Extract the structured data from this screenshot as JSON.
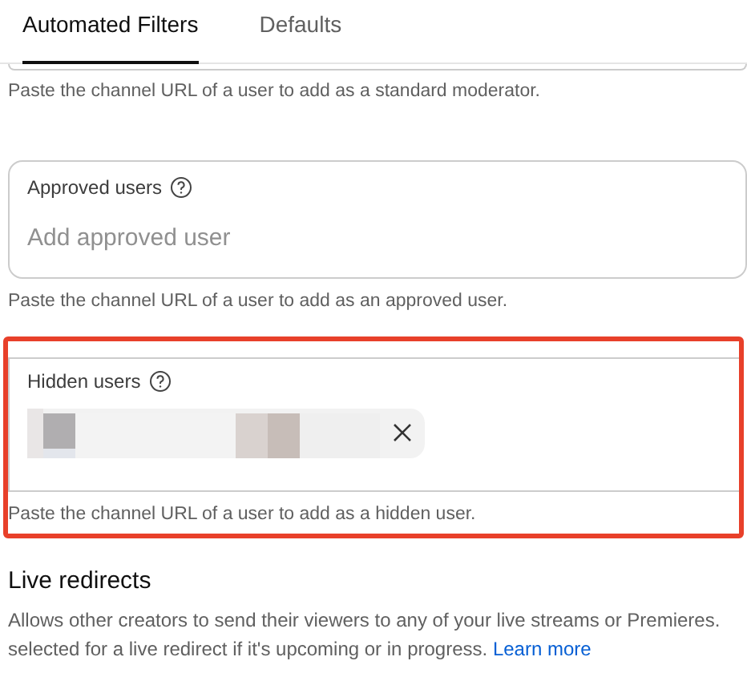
{
  "tabs": [
    {
      "label": "Automated Filters",
      "selected": true
    },
    {
      "label": "Defaults",
      "selected": false
    }
  ],
  "sections": [
    {
      "kind": "cut",
      "helper": "Paste the channel URL of a user to add as a standard moderator."
    },
    {
      "kind": "field",
      "label": "Approved users",
      "placeholder": "Add approved user",
      "helper": "Paste the channel URL of a user to add as an approved user."
    },
    {
      "kind": "chips",
      "label": "Hidden users",
      "chips": [
        {
          "kind": "redacted"
        }
      ],
      "helper": "Paste the channel URL of a user to add as a hidden user.",
      "highlighted": true
    }
  ],
  "live_redirects": {
    "title": "Live redirects",
    "lines": [
      "Allows other creators to send their viewers to any of your live streams or Premieres.",
      "selected for a live redirect if it's upcoming or in progress."
    ],
    "link": "Learn more"
  }
}
